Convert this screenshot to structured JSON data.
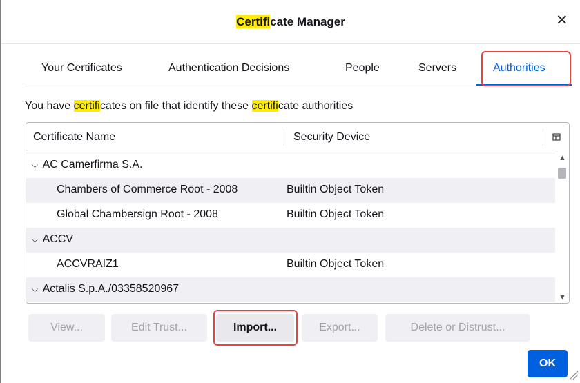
{
  "window": {
    "title_highlight": "Certifi",
    "title_rest": "cate Manager",
    "close_glyph": "✕"
  },
  "tabs": [
    {
      "label": "Your Certificates",
      "selected": false
    },
    {
      "label": "Authentication Decisions",
      "selected": false
    },
    {
      "label": "People",
      "selected": false
    },
    {
      "label": "Servers",
      "selected": false
    },
    {
      "label": "Authorities",
      "selected": true
    }
  ],
  "description": {
    "part1": "You have ",
    "hl1": "certifi",
    "part2": "cates on file that identify these ",
    "hl2": "certifi",
    "part3": "cate authorities"
  },
  "table": {
    "columns": [
      "Certificate Name",
      "Security Device"
    ],
    "rows": [
      {
        "type": "group",
        "name": "AC Camerfirma S.A.",
        "device": "",
        "twisty": "⌵"
      },
      {
        "type": "item",
        "name": "Chambers of Commerce Root - 2008",
        "device": "Builtin Object Token"
      },
      {
        "type": "item",
        "name": "Global Chambersign Root - 2008",
        "device": "Builtin Object Token"
      },
      {
        "type": "group",
        "name": "ACCV",
        "device": "",
        "twisty": "⌵"
      },
      {
        "type": "item",
        "name": "ACCVRAIZ1",
        "device": "Builtin Object Token"
      },
      {
        "type": "group",
        "name": "Actalis S.p.A./03358520967",
        "device": "",
        "twisty": "⌵"
      }
    ]
  },
  "buttons": {
    "view": "View...",
    "edit_trust": "Edit Trust...",
    "import": "Import...",
    "export": "Export...",
    "delete": "Delete or Distrust...",
    "ok": "OK"
  },
  "colors": {
    "accent": "#0061e0",
    "highlight": "#ffec00",
    "annotation_red": "#e24444"
  }
}
